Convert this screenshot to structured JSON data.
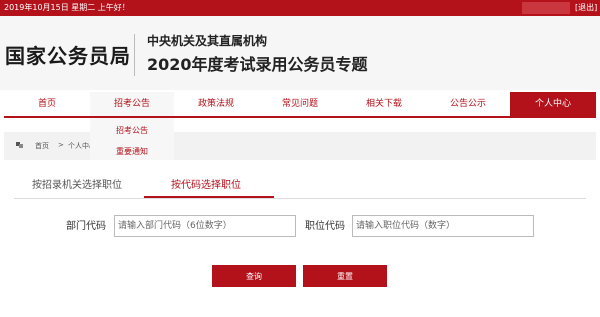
{
  "topbar": {
    "date_text": "2019年10月15日  星期二  上午好！",
    "logout_label": "[退出]"
  },
  "header": {
    "logo": "国家公务员局",
    "subtitle_line1": "中央机关及其直属机构",
    "subtitle_line2": "2020年度考试录用公务员专题"
  },
  "nav": {
    "items": [
      {
        "label": "首页"
      },
      {
        "label": "招考公告"
      },
      {
        "label": "政策法规"
      },
      {
        "label": "常见问题"
      },
      {
        "label": "相关下载"
      },
      {
        "label": "公告公示"
      },
      {
        "label": "个人中心"
      }
    ],
    "active_index": 6
  },
  "dropdown": {
    "items": [
      {
        "label": "招考公告"
      },
      {
        "label": "重要通知"
      }
    ]
  },
  "breadcrumb": {
    "home": "首页",
    "separator": ">",
    "current": "个人中心"
  },
  "tabs": [
    {
      "label": "按招录机关选择职位"
    },
    {
      "label": "按代码选择职位"
    }
  ],
  "active_tab_index": 1,
  "form": {
    "dept_code": {
      "label": "部门代码",
      "placeholder": "请输入部门代码（6位数字）"
    },
    "position_code": {
      "label": "职位代码",
      "placeholder": "请输入职位代码（数字）"
    }
  },
  "buttons": {
    "query": "查询",
    "reset": "重置"
  },
  "colors": {
    "accent": "#b3121b",
    "header_bg": "#f6f6f6",
    "crumb_bg": "#f2f2f2"
  }
}
